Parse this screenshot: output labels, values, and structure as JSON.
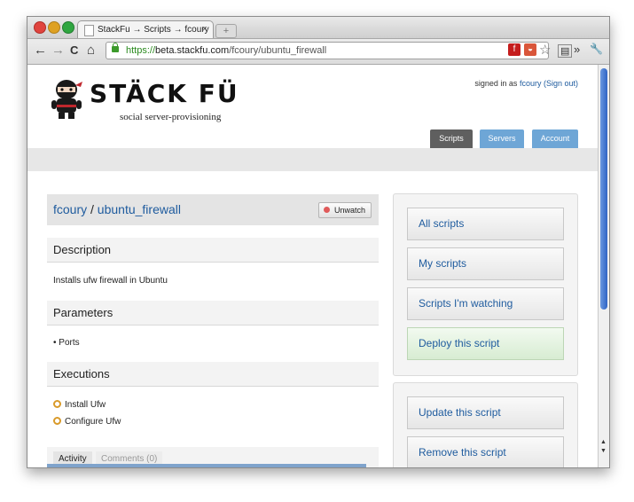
{
  "browser": {
    "tab_title": "StackFu → Scripts → fcoury",
    "tab_close": "×",
    "new_tab": "+",
    "url_scheme": "https://",
    "url_host": "beta.stackfu.com",
    "url_path": "/fcoury/ubuntu_firewall",
    "nav_back": "←",
    "nav_forward": "→",
    "nav_reload": "C",
    "nav_home": "⌂",
    "star": "☆",
    "overflow": "»",
    "wrench": "🔧"
  },
  "header": {
    "logo": "STÄCK FÜ",
    "tagline": "social server-provisioning",
    "signed_prefix": "signed in as",
    "username": "fcoury",
    "sign_out": "(Sign out)",
    "nav": [
      "Scripts",
      "Servers",
      "Account"
    ]
  },
  "script": {
    "owner": "fcoury",
    "separator": "/",
    "name": "ubuntu_firewall",
    "unwatch_label": "Unwatch",
    "description_title": "Description",
    "description": "Installs ufw firewall in Ubuntu",
    "parameters_title": "Parameters",
    "parameters": [
      "• Ports"
    ],
    "executions_title": "Executions",
    "executions": [
      "Install Ufw",
      "Configure Ufw"
    ],
    "activity_tabs": [
      "Activity",
      "Comments (0)"
    ]
  },
  "sidebar": {
    "top": [
      "All scripts",
      "My scripts",
      "Scripts I'm watching",
      "Deploy this script"
    ],
    "bottom": [
      "Update this script",
      "Remove this script"
    ]
  },
  "colors": {
    "link": "#1e5b9e",
    "nav_active": "#5f5f5f",
    "nav_inactive": "#6ea6d6",
    "deploy_bg": "#d7ecd2"
  }
}
